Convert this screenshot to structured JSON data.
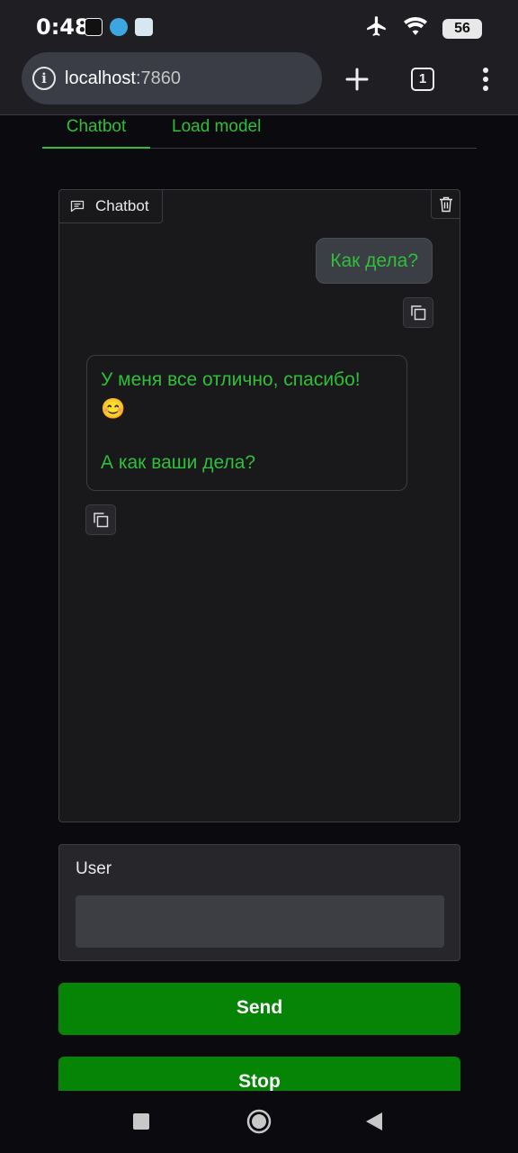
{
  "status_bar": {
    "time": "0:48",
    "battery": "56"
  },
  "browser": {
    "url_host": "localhost",
    "url_port": ":7860",
    "tab_count": "1"
  },
  "tabs": [
    {
      "label": "Chatbot",
      "active": true
    },
    {
      "label": "Load model",
      "active": false
    }
  ],
  "chatbot": {
    "label": "Chatbot",
    "messages": [
      {
        "role": "user",
        "text": "Как дела?"
      },
      {
        "role": "bot",
        "lines": [
          "У меня все отлично, спасибо!",
          "😊",
          "",
          "А как ваши дела?"
        ]
      }
    ]
  },
  "input": {
    "label": "User",
    "value": "",
    "placeholder": ""
  },
  "buttons": {
    "send": "Send",
    "stop": "Stop"
  },
  "colors": {
    "accent_green": "#2fbf3a",
    "button_green": "#058405",
    "background": "#0b0b0f"
  }
}
